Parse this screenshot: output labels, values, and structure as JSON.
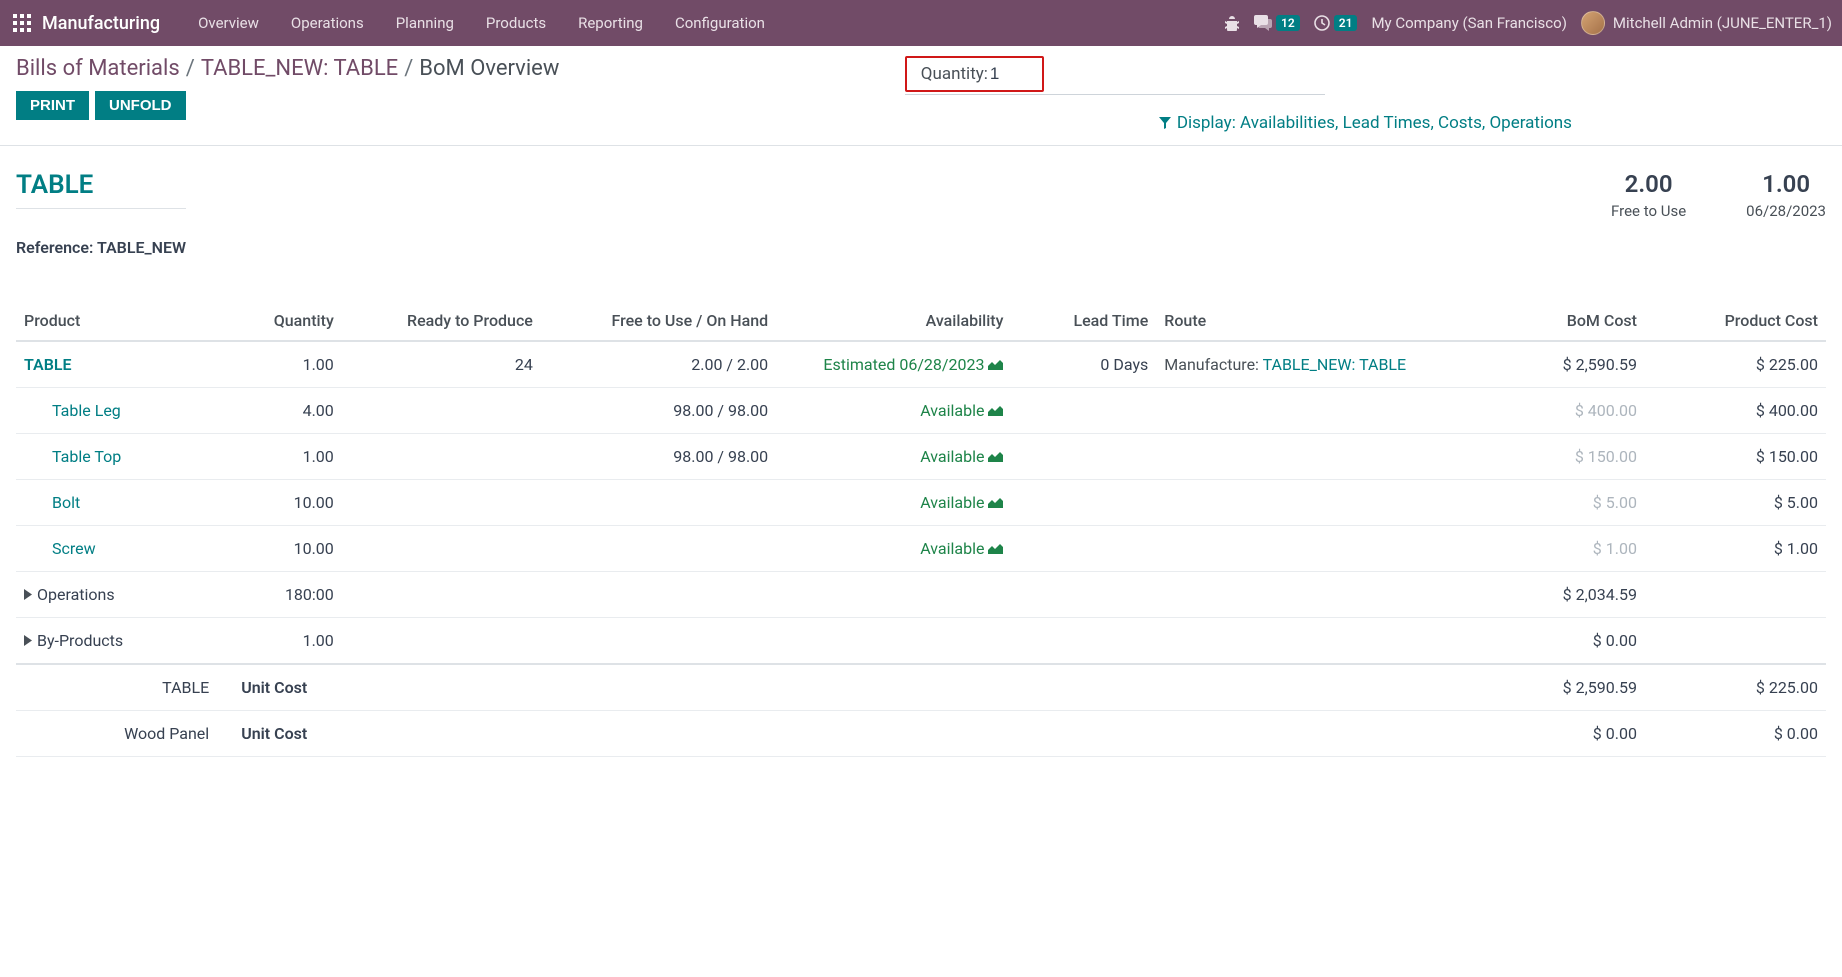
{
  "nav": {
    "brand": "Manufacturing",
    "menu": [
      "Overview",
      "Operations",
      "Planning",
      "Products",
      "Reporting",
      "Configuration"
    ],
    "messages_badge": "12",
    "activities_badge": "21",
    "company": "My Company (San Francisco)",
    "user": "Mitchell Admin (JUNE_ENTER_1)"
  },
  "breadcrumb": {
    "root": "Bills of Materials",
    "level1": "TABLE_NEW: TABLE",
    "active": "BoM Overview"
  },
  "buttons": {
    "print": "PRINT",
    "unfold": "UNFOLD"
  },
  "quantity": {
    "label": "Quantity:",
    "value": "1"
  },
  "display_filter": "Display: Availabilities, Lead Times, Costs, Operations",
  "header": {
    "title": "TABLE",
    "reference_label": "Reference:",
    "reference_value": "TABLE_NEW",
    "stat1_val": "2.00",
    "stat1_lbl": "Free to Use",
    "stat2_val": "1.00",
    "stat2_lbl": "06/28/2023"
  },
  "columns": {
    "product": "Product",
    "quantity": "Quantity",
    "ready": "Ready to Produce",
    "free": "Free to Use / On Hand",
    "availability": "Availability",
    "lead": "Lead Time",
    "route": "Route",
    "bom_cost": "BoM Cost",
    "prod_cost": "Product Cost"
  },
  "rows": [
    {
      "product": "TABLE",
      "qty": "1.00",
      "ready": "24",
      "free": "2.00 / 2.00",
      "avail": "Estimated 06/28/2023",
      "avail_icon": true,
      "lead": "0 Days",
      "route_prefix": "Manufacture: ",
      "route_link": "TABLE_NEW: TABLE",
      "bom_cost": "$ 2,590.59",
      "prod_cost": "$ 225.00",
      "level": 0,
      "bold": true
    },
    {
      "product": "Table Leg",
      "qty": "4.00",
      "ready": "",
      "free": "98.00 / 98.00",
      "avail": "Available",
      "avail_icon": true,
      "lead": "",
      "route_prefix": "",
      "route_link": "",
      "bom_cost": "$ 400.00",
      "bom_muted": true,
      "prod_cost": "$ 400.00",
      "level": 1
    },
    {
      "product": "Table Top",
      "qty": "1.00",
      "ready": "",
      "free": "98.00 / 98.00",
      "avail": "Available",
      "avail_icon": true,
      "lead": "",
      "route_prefix": "",
      "route_link": "",
      "bom_cost": "$ 150.00",
      "bom_muted": true,
      "prod_cost": "$ 150.00",
      "level": 1
    },
    {
      "product": "Bolt",
      "qty": "10.00",
      "ready": "",
      "free": "",
      "avail": "Available",
      "avail_icon": true,
      "lead": "",
      "route_prefix": "",
      "route_link": "",
      "bom_cost": "$ 5.00",
      "bom_muted": true,
      "prod_cost": "$ 5.00",
      "level": 1
    },
    {
      "product": "Screw",
      "qty": "10.00",
      "ready": "",
      "free": "",
      "avail": "Available",
      "avail_icon": true,
      "lead": "",
      "route_prefix": "",
      "route_link": "",
      "bom_cost": "$ 1.00",
      "bom_muted": true,
      "prod_cost": "$ 1.00",
      "level": 1
    },
    {
      "product": "Operations",
      "qty": "180:00",
      "caret": true,
      "bom_cost": "$ 2,034.59",
      "prod_cost": "",
      "level": 0,
      "plain": true
    },
    {
      "product": "By-Products",
      "qty": "1.00",
      "caret": true,
      "bom_cost": "$ 0.00",
      "prod_cost": "",
      "level": 0,
      "plain": true
    }
  ],
  "summary": [
    {
      "name": "TABLE",
      "label": "Unit Cost",
      "bom_cost": "$ 2,590.59",
      "prod_cost": "$ 225.00"
    },
    {
      "name": "Wood Panel",
      "label": "Unit Cost",
      "bom_cost": "$ 0.00",
      "prod_cost": "$ 0.00"
    }
  ]
}
